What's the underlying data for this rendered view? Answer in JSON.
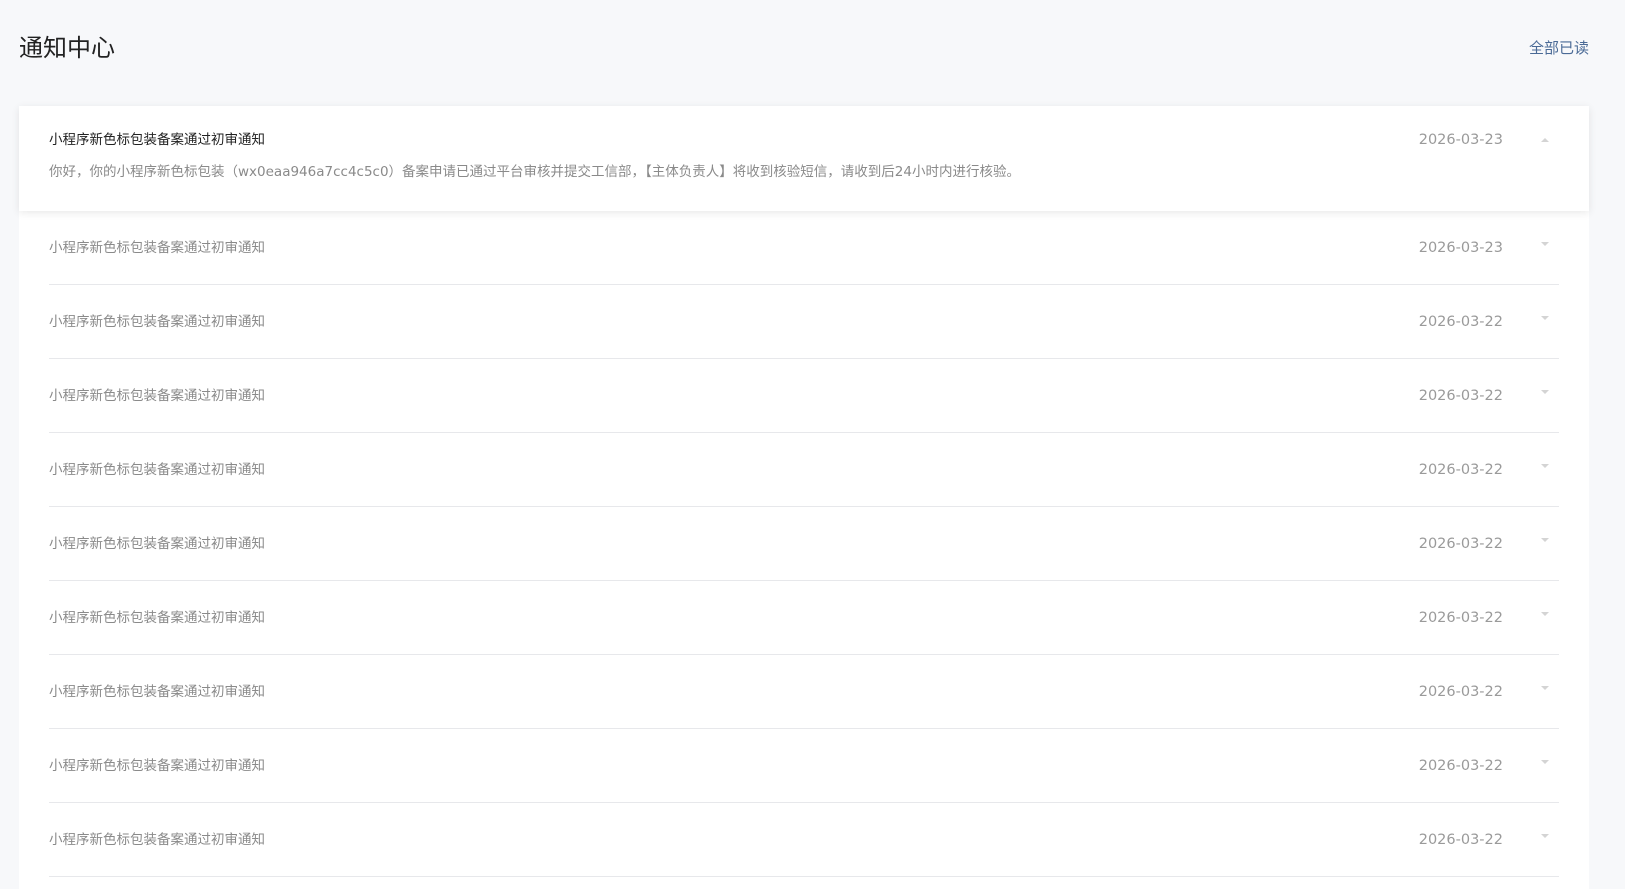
{
  "header": {
    "title": "通知中心",
    "mark_all_read": "全部已读"
  },
  "notifications": [
    {
      "title": "小程序新色标包装备案通过初审通知",
      "date": "2026-03-23",
      "body": "你好，你的小程序新色标包装（wx0eaa946a7cc4c5c0）备案申请已通过平台审核并提交工信部，【主体负责人】将收到核验短信，请收到后24小时内进行核验。",
      "expanded": true
    },
    {
      "title": "小程序新色标包装备案通过初审通知",
      "date": "2026-03-23"
    },
    {
      "title": "小程序新色标包装备案通过初审通知",
      "date": "2026-03-22"
    },
    {
      "title": "小程序新色标包装备案通过初审通知",
      "date": "2026-03-22"
    },
    {
      "title": "小程序新色标包装备案通过初审通知",
      "date": "2026-03-22"
    },
    {
      "title": "小程序新色标包装备案通过初审通知",
      "date": "2026-03-22"
    },
    {
      "title": "小程序新色标包装备案通过初审通知",
      "date": "2026-03-22"
    },
    {
      "title": "小程序新色标包装备案通过初审通知",
      "date": "2026-03-22"
    },
    {
      "title": "小程序新色标包装备案通过初审通知",
      "date": "2026-03-22"
    },
    {
      "title": "小程序新色标包装备案通过初审通知",
      "date": "2026-03-22"
    }
  ],
  "colors": {
    "accent": "#4a6a96",
    "background": "#f7f8fa"
  }
}
